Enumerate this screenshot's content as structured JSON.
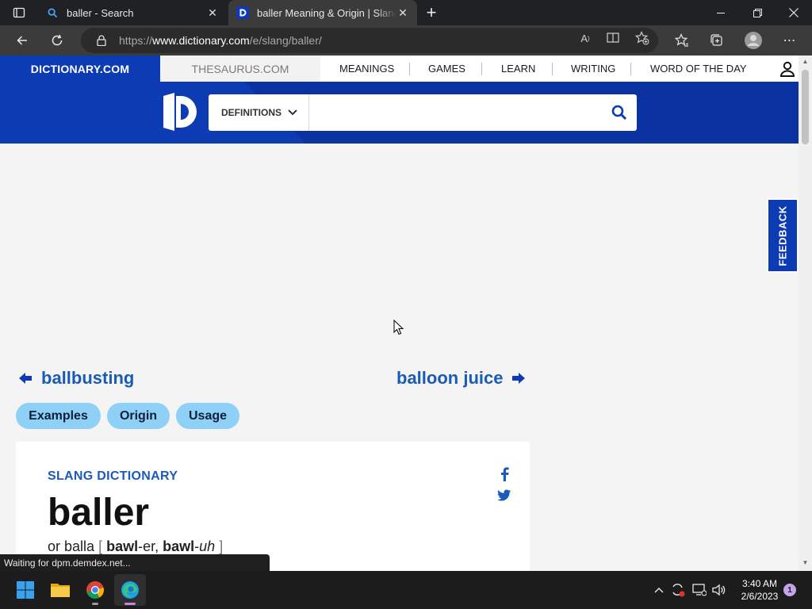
{
  "browser": {
    "tabs": [
      {
        "title": "baller - Search",
        "active": false
      },
      {
        "title": "baller Meaning & Origin | Slang by Dictionary.com",
        "active": true
      }
    ],
    "new_tab_symbol": "+",
    "url_prefix": "https://",
    "url_domain": "www.dictionary.com",
    "url_path": "/e/slang/baller/",
    "status_text": "Waiting for dpm.demdex.net..."
  },
  "site": {
    "brand": "DICTIONARY.COM",
    "thesaurus": "THESAURUS.COM",
    "nav": [
      "MEANINGS",
      "GAMES",
      "LEARN",
      "WRITING",
      "WORD OF THE DAY"
    ],
    "search": {
      "dropdown_label": "DEFINITIONS",
      "placeholder": ""
    },
    "feedback_label": "FEEDBACK"
  },
  "entry": {
    "prev_word": "ballbusting",
    "next_word": "balloon juice",
    "sections": [
      "Examples",
      "Origin",
      "Usage"
    ],
    "kicker": "SLANG DICTIONARY",
    "word": "baller",
    "alt_prefix": "or balla",
    "pron_open": "[",
    "pron1_bold": "bawl",
    "pron1_rest": "-er,",
    "pron2_bold": "bawl",
    "pron2_rest": "-",
    "pron2_italic": "uh",
    "pron_close": "]"
  },
  "taskbar": {
    "time": "3:40 AM",
    "date": "2/6/2023",
    "notification_count": "1"
  },
  "colors": {
    "brand_blue": "#0d3bb3",
    "link_blue": "#1a5bb8",
    "pill_blue": "#8fd0f7"
  }
}
